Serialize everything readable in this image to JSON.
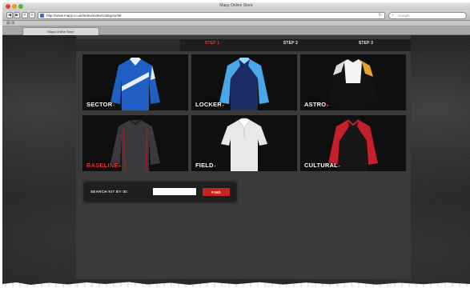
{
  "window": {
    "title": "Mapy Online Store",
    "url": "http://www.mapy.co.uk/index/index/category/68",
    "search_placeholder": "Google",
    "tab_label": "Mapy Online Store"
  },
  "steps": [
    {
      "title": "STEP 1",
      "sub": "",
      "active": true
    },
    {
      "title": "STEP 2",
      "sub": "",
      "active": false
    },
    {
      "title": "STEP 3",
      "sub": "",
      "active": false
    }
  ],
  "kits": [
    {
      "name": "SECTOR",
      "icon": "shirt-blue-icon",
      "highlight": false
    },
    {
      "name": "LOCKER",
      "icon": "shirt-navy-skyblue-icon",
      "highlight": false
    },
    {
      "name": "ASTRO",
      "icon": "shirt-black-white-gold-icon",
      "highlight": false
    },
    {
      "name": "BASELINE",
      "icon": "shirt-charcoal-icon",
      "highlight": true
    },
    {
      "name": "FIELD",
      "icon": "shirt-white-polo-icon",
      "highlight": false
    },
    {
      "name": "CULTURAL",
      "icon": "shirt-red-black-icon",
      "highlight": false
    }
  ],
  "search": {
    "label": "SEARCH KIT BY ID:",
    "value": "",
    "button_label": "FIND"
  },
  "colors": {
    "accent": "#e5322d",
    "panel": "#3a3a3a",
    "tile": "#0f0f0f"
  }
}
